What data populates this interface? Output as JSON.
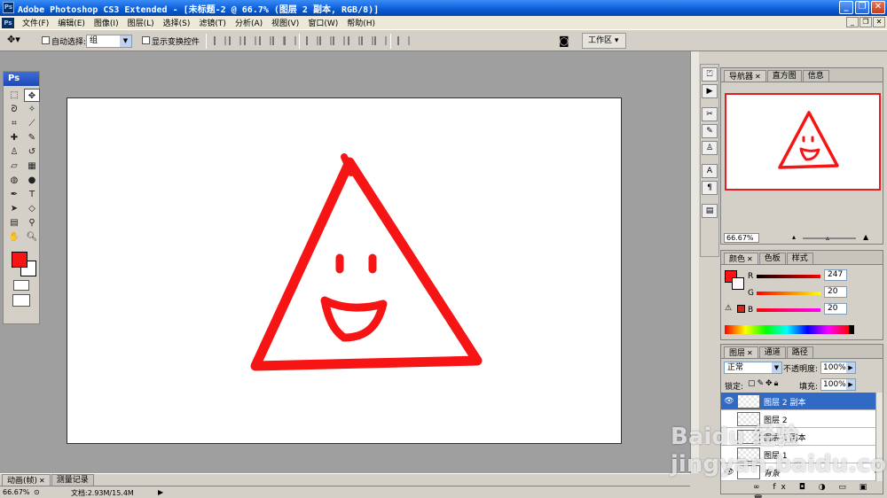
{
  "window": {
    "title": "Adobe Photoshop CS3 Extended - [未标题-2 @ 66.7% (图层 2 副本, RGB/8)]",
    "app_icon": "Ps",
    "controls": [
      "_",
      "❐",
      "✕"
    ]
  },
  "menu": {
    "items": [
      "文件(F)",
      "编辑(E)",
      "图像(I)",
      "图层(L)",
      "选择(S)",
      "滤镜(T)",
      "分析(A)",
      "视图(V)",
      "窗口(W)",
      "帮助(H)"
    ],
    "doc_controls": [
      "_",
      "❐",
      "✕"
    ]
  },
  "options_bar": {
    "auto_select_label": "自动选择:",
    "auto_select_value": "组",
    "show_transform_label": "显示变换控件",
    "workspace_label": "工作区 ▾"
  },
  "toolbox": {
    "header": "Ps",
    "foreground_color": "#f71414",
    "background_color": "#ffffff"
  },
  "navigator": {
    "tabs": [
      "导航器",
      "直方图",
      "信息"
    ],
    "zoom": "66.67%"
  },
  "color_panel": {
    "tabs": [
      "颜色",
      "色板",
      "样式"
    ],
    "channels": [
      {
        "name": "R",
        "value": "247"
      },
      {
        "name": "G",
        "value": "20"
      },
      {
        "name": "B",
        "value": "20"
      }
    ],
    "swatch_color": "#f71414"
  },
  "layers_panel": {
    "tabs": [
      "图层",
      "通道",
      "路径"
    ],
    "blend_mode": "正常",
    "opacity_label": "不透明度:",
    "opacity": "100%",
    "lock_label": "锁定:",
    "fill_label": "填充:",
    "fill": "100%",
    "layers": [
      {
        "name": "图层 2 副本",
        "visible": true,
        "active": true
      },
      {
        "name": "图层 2",
        "visible": false,
        "active": false
      },
      {
        "name": "图层 1 副本",
        "visible": false,
        "active": false
      },
      {
        "name": "图层 1",
        "visible": false,
        "active": false
      },
      {
        "name": "背景",
        "visible": true,
        "active": false
      }
    ]
  },
  "bottom": {
    "tabs": [
      "动画(帧)",
      "测量记录"
    ],
    "zoom": "66.67%",
    "doc_info": "文档:2.93M/15.4M"
  },
  "watermark": "Baidu 经验 jingyan.baidu.com"
}
